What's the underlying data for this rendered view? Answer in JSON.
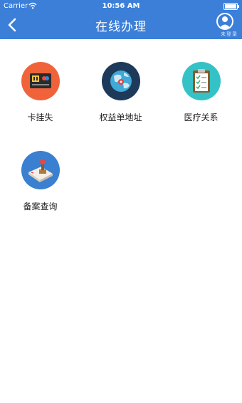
{
  "status_bar": {
    "carrier": "Carrier",
    "time": "10:56 AM"
  },
  "nav": {
    "title": "在线办理",
    "profile_caption": "未登录"
  },
  "grid": {
    "items": [
      {
        "label": "卡挂失",
        "icon": "card-icon",
        "color": "#f0633a"
      },
      {
        "label": "权益单地址",
        "icon": "globe-pin-icon",
        "color": "#1e3a5a"
      },
      {
        "label": "医疗关系",
        "icon": "clipboard-icon",
        "color": "#35c2c7"
      },
      {
        "label": "备案查询",
        "icon": "stamp-icon",
        "color": "#3a7fd0"
      }
    ]
  }
}
